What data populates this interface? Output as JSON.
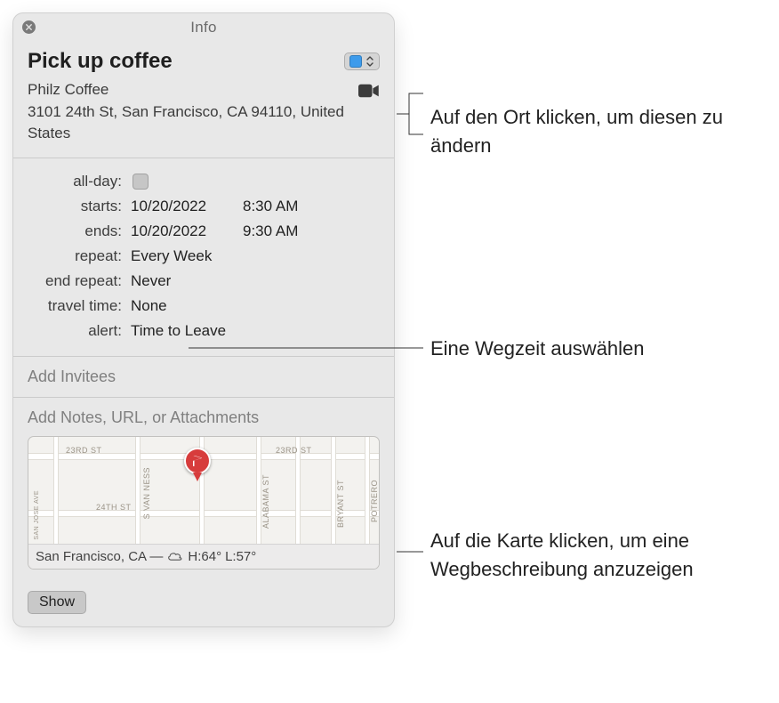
{
  "window": {
    "title": "Info"
  },
  "header": {
    "event_title": "Pick up coffee",
    "location_name": "Philz Coffee",
    "location_address": "3101 24th St, San Francisco, CA 94110, United States"
  },
  "details": {
    "labels": {
      "all_day": "all-day:",
      "starts": "starts:",
      "ends": "ends:",
      "repeat": "repeat:",
      "end_repeat": "end repeat:",
      "travel_time": "travel time:",
      "alert": "alert:"
    },
    "starts_date": "10/20/2022",
    "starts_time": "8:30 AM",
    "ends_date": "10/20/2022",
    "ends_time": "9:30 AM",
    "repeat": "Every Week",
    "end_repeat": "Never",
    "travel_time": "None",
    "alert": "Time to Leave"
  },
  "sections": {
    "add_invitees": "Add Invitees",
    "add_notes": "Add Notes, URL, or Attachments"
  },
  "map": {
    "weather_location": "San Francisco, CA —",
    "weather_hi": "H:64°",
    "weather_lo": "L:57°",
    "streets": {
      "h1": "23RD ST",
      "h1b": "23RD ST",
      "h2": "24TH ST",
      "v1": "SAN JOSE AVE",
      "v2": "S VAN NESS",
      "v3": "ALABAMA ST",
      "v4": "BRYANT ST",
      "v5": "POTRERO"
    }
  },
  "footer": {
    "show": "Show"
  },
  "callouts": {
    "location": "Auf den Ort klicken, um diesen zu ändern",
    "travel": "Eine Wegzeit auswählen",
    "map": "Auf die Karte klicken, um eine Wegbeschreibung anzuzeigen"
  }
}
